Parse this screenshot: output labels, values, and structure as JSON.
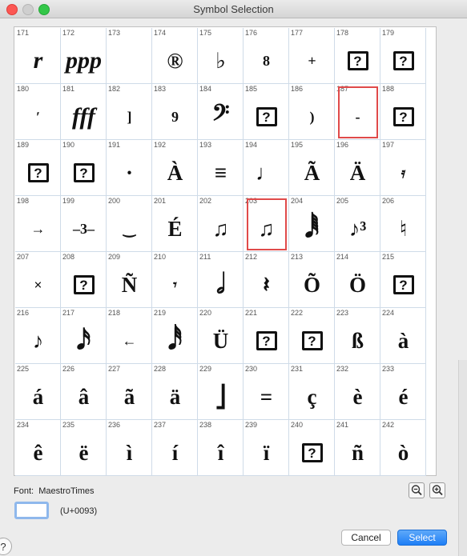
{
  "window": {
    "title": "Symbol Selection"
  },
  "grid": {
    "cells": [
      {
        "num": "171",
        "glyph": "r",
        "style": "italic"
      },
      {
        "num": "172",
        "glyph": "ppp",
        "style": "italic"
      },
      {
        "num": "173",
        "glyph": "",
        "style": ""
      },
      {
        "num": "174",
        "glyph": "®",
        "style": ""
      },
      {
        "num": "175",
        "glyph": "♭",
        "style": ""
      },
      {
        "num": "176",
        "glyph": "8",
        "style": "small"
      },
      {
        "num": "177",
        "glyph": "+",
        "style": "small"
      },
      {
        "num": "178",
        "glyph": "?",
        "style": "missing"
      },
      {
        "num": "179",
        "glyph": "?",
        "style": "missing"
      },
      {
        "num": "180",
        "glyph": "ʹ",
        "style": "small"
      },
      {
        "num": "181",
        "glyph": "fff",
        "style": "italic"
      },
      {
        "num": "182",
        "glyph": "]",
        "style": "small"
      },
      {
        "num": "183",
        "glyph": "9",
        "style": "small"
      },
      {
        "num": "184",
        "glyph": "𝄢",
        "style": "large"
      },
      {
        "num": "185",
        "glyph": "?",
        "style": "missing"
      },
      {
        "num": "186",
        "glyph": ")",
        "style": "small"
      },
      {
        "num": "187",
        "glyph": "-",
        "style": "small"
      },
      {
        "num": "188",
        "glyph": "?",
        "style": "missing"
      },
      {
        "num": "189",
        "glyph": "?",
        "style": "missing"
      },
      {
        "num": "190",
        "glyph": "?",
        "style": "missing"
      },
      {
        "num": "191",
        "glyph": "·",
        "style": ""
      },
      {
        "num": "192",
        "glyph": "À",
        "style": ""
      },
      {
        "num": "193",
        "glyph": "≡",
        "style": ""
      },
      {
        "num": "194",
        "glyph": "♩",
        "style": ""
      },
      {
        "num": "195",
        "glyph": "Ã",
        "style": ""
      },
      {
        "num": "196",
        "glyph": "Ä",
        "style": ""
      },
      {
        "num": "197",
        "glyph": "𝄿",
        "style": "small"
      },
      {
        "num": "198",
        "glyph": "→",
        "style": "small"
      },
      {
        "num": "199",
        "glyph": "–3–",
        "style": "small"
      },
      {
        "num": "200",
        "glyph": "‿",
        "style": "small"
      },
      {
        "num": "201",
        "glyph": "É",
        "style": ""
      },
      {
        "num": "202",
        "glyph": "♫",
        "style": ""
      },
      {
        "num": "203",
        "glyph": "♫",
        "style": ""
      },
      {
        "num": "204",
        "glyph": "𝅘𝅥𝅱",
        "style": "large"
      },
      {
        "num": "205",
        "glyph": "♪³",
        "style": ""
      },
      {
        "num": "206",
        "glyph": "♮",
        "style": ""
      },
      {
        "num": "207",
        "glyph": "×",
        "style": "small"
      },
      {
        "num": "208",
        "glyph": "?",
        "style": "missing"
      },
      {
        "num": "209",
        "glyph": "Ñ",
        "style": ""
      },
      {
        "num": "210",
        "glyph": "𝄾",
        "style": "small"
      },
      {
        "num": "211",
        "glyph": "𝅗𝅥",
        "style": "large"
      },
      {
        "num": "212",
        "glyph": "𝄽",
        "style": ""
      },
      {
        "num": "213",
        "glyph": "Õ",
        "style": ""
      },
      {
        "num": "214",
        "glyph": "Ö",
        "style": ""
      },
      {
        "num": "215",
        "glyph": "?",
        "style": "missing"
      },
      {
        "num": "216",
        "glyph": "♪",
        "style": ""
      },
      {
        "num": "217",
        "glyph": "𝅘𝅥𝅯",
        "style": "large"
      },
      {
        "num": "218",
        "glyph": "←",
        "style": "small"
      },
      {
        "num": "219",
        "glyph": "𝅘𝅥𝅰",
        "style": "large"
      },
      {
        "num": "220",
        "glyph": "Ü",
        "style": ""
      },
      {
        "num": "221",
        "glyph": "?",
        "style": "missing"
      },
      {
        "num": "222",
        "glyph": "?",
        "style": "missing"
      },
      {
        "num": "223",
        "glyph": "ß",
        "style": ""
      },
      {
        "num": "224",
        "glyph": "à",
        "style": ""
      },
      {
        "num": "225",
        "glyph": "á",
        "style": ""
      },
      {
        "num": "226",
        "glyph": "â",
        "style": ""
      },
      {
        "num": "227",
        "glyph": "ã",
        "style": ""
      },
      {
        "num": "228",
        "glyph": "ä",
        "style": ""
      },
      {
        "num": "229",
        "glyph": "⎦",
        "style": ""
      },
      {
        "num": "230",
        "glyph": "=",
        "style": ""
      },
      {
        "num": "231",
        "glyph": "ç",
        "style": ""
      },
      {
        "num": "232",
        "glyph": "è",
        "style": ""
      },
      {
        "num": "233",
        "glyph": "é",
        "style": ""
      },
      {
        "num": "234",
        "glyph": "ê",
        "style": ""
      },
      {
        "num": "235",
        "glyph": "ë",
        "style": ""
      },
      {
        "num": "236",
        "glyph": "ì",
        "style": ""
      },
      {
        "num": "237",
        "glyph": "í",
        "style": ""
      },
      {
        "num": "238",
        "glyph": "î",
        "style": ""
      },
      {
        "num": "239",
        "glyph": "ï",
        "style": ""
      },
      {
        "num": "240",
        "glyph": "?",
        "style": "missing"
      },
      {
        "num": "241",
        "glyph": "ñ",
        "style": ""
      },
      {
        "num": "242",
        "glyph": "ò",
        "style": ""
      }
    ],
    "highlighted_cells": [
      "187",
      "203"
    ],
    "highlight_color": "#e04a4a"
  },
  "footer": {
    "font_label": "Font:",
    "font_name": "MaestroTimes",
    "unicode_label": "(U+0093)",
    "cancel_label": "Cancel",
    "select_label": "Select",
    "help_label": "?",
    "zoom_out_icon": "zoom-out-icon",
    "zoom_in_icon": "zoom-in-icon"
  },
  "colors": {
    "accent": "#1e7ef6",
    "grid_line": "#cfdbe8"
  }
}
